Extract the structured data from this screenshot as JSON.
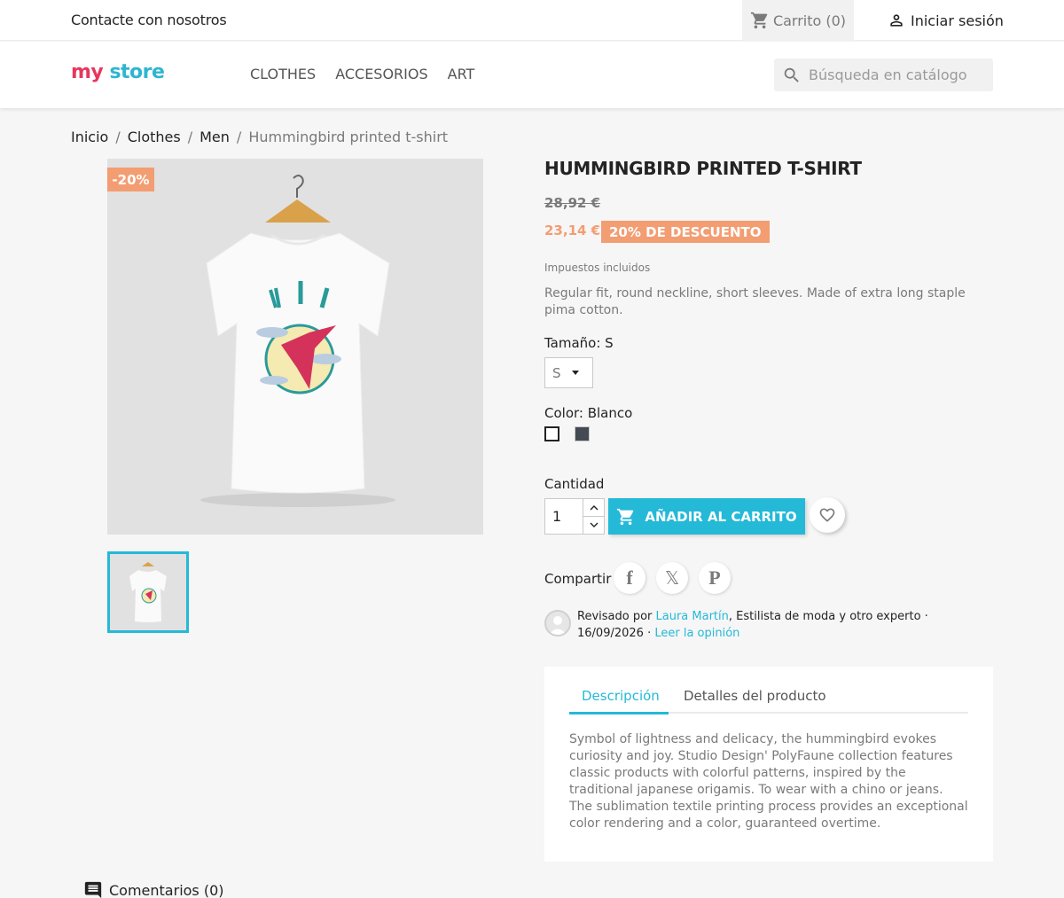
{
  "topbar": {
    "contact": "Contacte con nosotros",
    "cart": "Carrito (0)",
    "signin": "Iniciar sesión"
  },
  "header": {
    "logo_part1": "my",
    "logo_part2": "store",
    "nav": [
      "CLOTHES",
      "ACCESORIOS",
      "ART"
    ],
    "search_placeholder": "Búsqueda en catálogo"
  },
  "breadcrumb": [
    "Inicio",
    "Clothes",
    "Men",
    "Hummingbird printed t-shirt"
  ],
  "product": {
    "discount_flag": "-20%",
    "title": "HUMMINGBIRD PRINTED T-SHIRT",
    "regular_price": "28,92 €",
    "current_price": "23,14 €",
    "discount_badge": "20% DE DESCUENTO",
    "tax_label": "Impuestos incluidos",
    "short_description": "Regular fit, round neckline, short sleeves. Made of extra long staple pima cotton.",
    "size_label": "Tamaño: S",
    "size_value": "S",
    "color_label": "Color: Blanco",
    "colors": [
      "#ffffff",
      "#434a54"
    ],
    "quantity_label": "Cantidad",
    "quantity_value": "1",
    "add_to_cart": "AÑADIR AL CARRITO",
    "share_label": "Compartir"
  },
  "review": {
    "prefix": "Revisado por ",
    "author": "Laura Martín",
    "role": ", Estilista de moda y otro experto",
    "date": "16/09/2026",
    "read_link": "Leer la opinión"
  },
  "tabs": {
    "description": "Descripción",
    "details": "Detalles del producto",
    "description_text": "Symbol of lightness and delicacy, the hummingbird evokes curiosity and joy. Studio Design' PolyFaune collection features classic products with colorful patterns, inspired by the traditional japanese origamis. To wear with a chino or jeans. The sublimation textile printing process provides an exceptional color rendering and a color, guaranteed overtime."
  },
  "comments": "Comentarios (0)",
  "colors": {
    "accent": "#24b9d7",
    "discount": "#f39d72"
  }
}
